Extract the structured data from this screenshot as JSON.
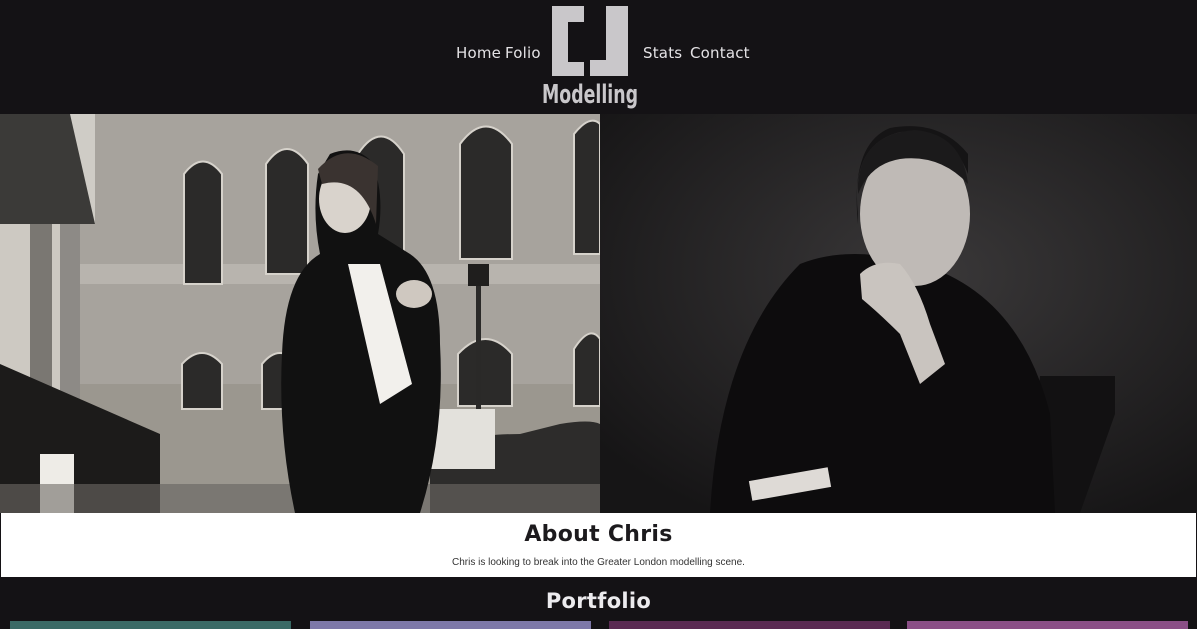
{
  "nav": {
    "home": "Home",
    "folio": "Folio",
    "stats": "Stats",
    "contact": "Contact"
  },
  "logo": {
    "monogram": "CJ",
    "wordmark": "Modelling"
  },
  "hero": {
    "left_photo": "street-portrait",
    "right_photo": "seated-portrait"
  },
  "about": {
    "title": "About Chris",
    "text": "Chris is looking to break into the Greater London modelling scene."
  },
  "portfolio": {
    "title": "Portfolio",
    "thumb_colors": [
      "#3a6a66",
      "#7d78a8",
      "#5a2a52",
      "#8a4f86"
    ]
  },
  "colors": {
    "background": "#141215",
    "nav_text": "#e4e2e5",
    "logo": "#c9c7ca",
    "about_bg": "#ffffff"
  }
}
